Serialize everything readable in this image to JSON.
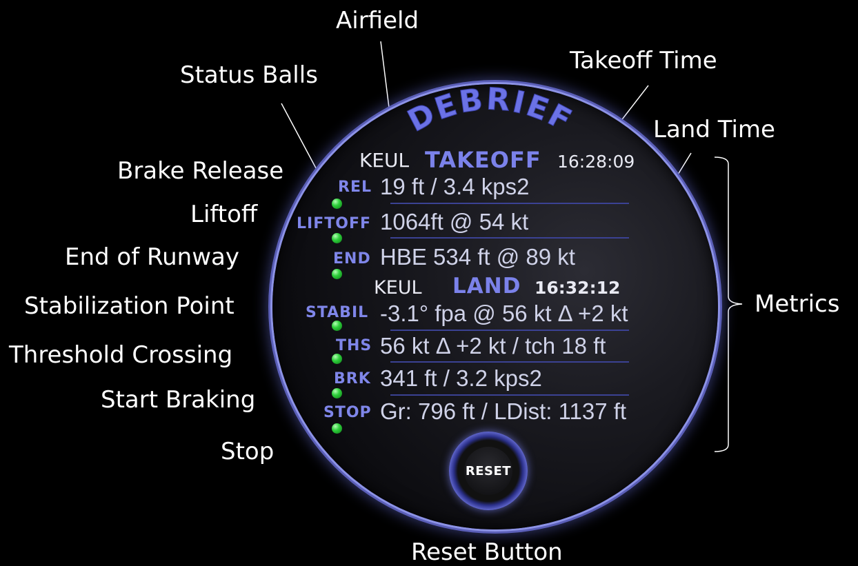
{
  "annotations": {
    "airfield": "Airfield",
    "takeoff_time": "Takeoff Time",
    "status_balls": "Status Balls",
    "land_time": "Land Time",
    "brake_release": "Brake Release",
    "liftoff": "Liftoff",
    "end_of_runway": "End of Runway",
    "stabilization_point": "Stabilization Point",
    "threshold_crossing": "Threshold Crossing",
    "start_braking": "Start Braking",
    "stop": "Stop",
    "metrics": "Metrics",
    "reset_button": "Reset Button"
  },
  "dial": {
    "title": "DEBRIEF",
    "takeoff": {
      "airfield": "KEUL",
      "label": "TAKEOFF",
      "time": "16:28:09"
    },
    "land": {
      "airfield": "KEUL",
      "label": "LAND",
      "time": "16:32:12"
    },
    "rows": [
      {
        "label": "REL",
        "value": "19 ft / 3.4 kps2",
        "status": "green"
      },
      {
        "label": "LIFTOFF",
        "value": "1064ft @ 54 kt",
        "status": "green"
      },
      {
        "label": "END",
        "value": "HBE 534 ft @ 89 kt",
        "status": "green"
      },
      {
        "label": "STABIL",
        "value": "-3.1° fpa @ 56 kt Δ +2 kt",
        "status": "green"
      },
      {
        "label": "THS",
        "value": "56 kt Δ +2 kt / tch 18 ft",
        "status": "green"
      },
      {
        "label": "BRK",
        "value": "341 ft / 3.2 kps2",
        "status": "green"
      },
      {
        "label": "STOP",
        "value": "Gr: 796 ft / LDist: 1137 ft",
        "status": "green"
      }
    ],
    "reset_label": "RESET"
  },
  "colors": {
    "accent": "#7b82ea",
    "status_green": "#2fd03c",
    "background": "#000000"
  }
}
